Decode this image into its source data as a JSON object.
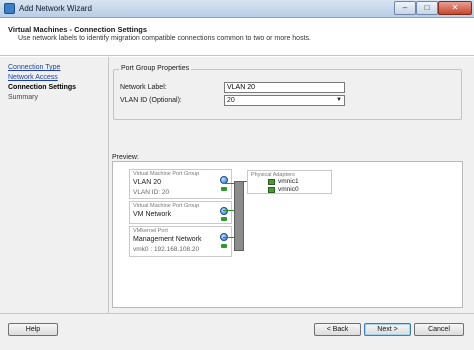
{
  "window": {
    "title": "Add Network Wizard",
    "controls": {
      "minimize": "–",
      "maximize": "□",
      "close": "✕"
    }
  },
  "header": {
    "title": "Virtual Machines - Connection Settings",
    "subtitle": "Use network labels to identify migration compatible connections common to two or more hosts."
  },
  "nav": {
    "items": [
      {
        "label": "Connection Type",
        "state": "link"
      },
      {
        "label": "Network Access",
        "state": "link"
      },
      {
        "label": "Connection Settings",
        "state": "active"
      },
      {
        "label": "Summary",
        "state": "inactive"
      }
    ]
  },
  "port_group_properties": {
    "legend": "Port Group Properties",
    "network_label_caption": "Network Label:",
    "network_label_value": "VLAN 20",
    "vlan_id_caption": "VLAN ID (Optional):",
    "vlan_id_value": "20",
    "dropdown_arrow": "▼"
  },
  "preview": {
    "label": "Preview:",
    "port_groups": [
      {
        "header": "Virtual Machine Port Group",
        "name": "VLAN 20",
        "detail": "VLAN ID: 20"
      },
      {
        "header": "Virtual Machine Port Group",
        "name": "VM Network",
        "detail": ""
      },
      {
        "header": "VMkernel Port",
        "name": "Management Network",
        "detail": "vmk0 : 192.168.108.20"
      }
    ],
    "physical_adapters": {
      "header": "Physical Adapters",
      "nics": [
        "vmnic1",
        "vmnic0"
      ]
    }
  },
  "footer": {
    "help": "Help",
    "back": "< Back",
    "next": "Next >",
    "cancel": "Cancel"
  },
  "colors": {
    "link": "#1b3fa8",
    "connection_line": "#2f8f2f",
    "title_bar": "#b9cde6",
    "close_button": "#c7462f"
  }
}
